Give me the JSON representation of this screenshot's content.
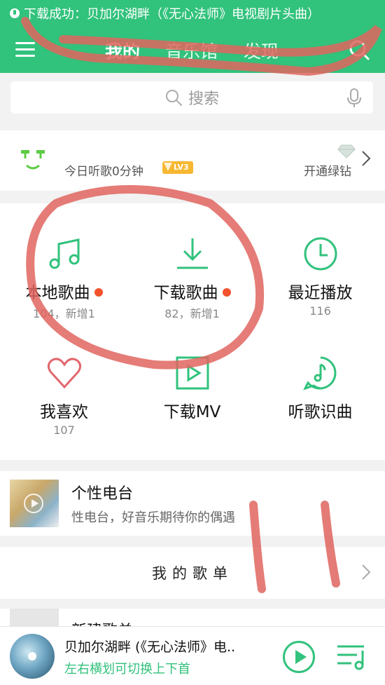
{
  "notice": {
    "text": "下载成功：贝加尔湖畔（《无心法师》电视剧片头曲）"
  },
  "nav": {
    "tabs": [
      "我的",
      "音乐馆",
      "发现"
    ],
    "active": "我的"
  },
  "search": {
    "placeholder": "搜索"
  },
  "profile": {
    "listen_text": "今日听歌0分钟",
    "level": "LV3",
    "vip_text": "开通绿钻"
  },
  "grid": {
    "items": [
      {
        "label": "本地歌曲",
        "count": "104，新增1",
        "icon": "music-note-icon",
        "has_dot": true
      },
      {
        "label": "下载歌曲",
        "count": "82，新增1",
        "icon": "download-icon",
        "has_dot": true
      },
      {
        "label": "最近播放",
        "count": "116",
        "icon": "clock-icon",
        "has_dot": false
      },
      {
        "label": "我喜欢",
        "count": "107",
        "icon": "heart-icon",
        "has_dot": false
      },
      {
        "label": "下载MV",
        "count": "",
        "icon": "video-play-icon",
        "has_dot": false
      },
      {
        "label": "听歌识曲",
        "count": "",
        "icon": "music-recognition-icon",
        "has_dot": false
      }
    ]
  },
  "radio": {
    "title": "个性电台",
    "subtitle": "性电台，好音乐期待你的偶遇"
  },
  "playlists": {
    "title": "我的歌单"
  },
  "new_playlist": {
    "label": "新建歌单"
  },
  "player": {
    "song": "贝加尔湖畔 (《无心法师》电..",
    "hint": "左右横划可切换上下首"
  },
  "colors": {
    "brand": "#31c27c",
    "dot": "#f0522c",
    "annotation": "#e0655f"
  }
}
